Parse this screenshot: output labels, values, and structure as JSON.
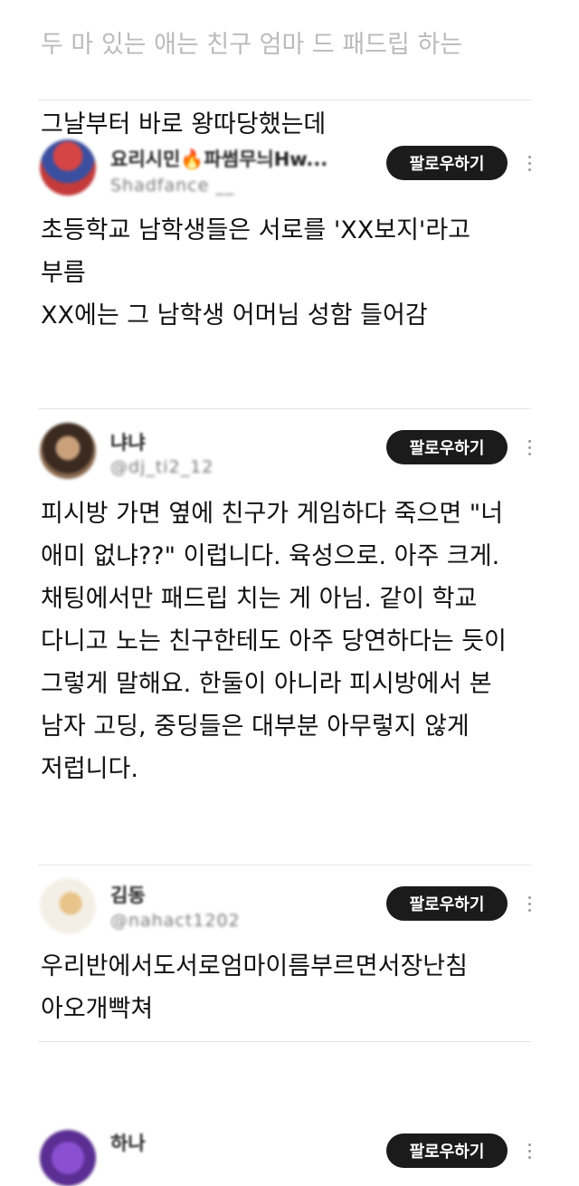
{
  "top_text": {
    "cut_line": "두 마 있는 애는 친구 엄마 드 패드립 하는",
    "line": "그날부터 바로 왕따당했는데"
  },
  "posts": [
    {
      "name": "요리시민🔥파썸무늬Hw...",
      "handle": "Shadfance __",
      "follow_label": "팔로우하기",
      "text": "초등학교 남학생들은 서로를 'XX보지'라고\n부름\nXX에는 그 남학생 어머님 성함 들어감"
    },
    {
      "name": "냐냐",
      "handle": "@dj_ti2_12",
      "follow_label": "팔로우하기",
      "text": "피시방 가면 옆에 친구가 게임하다 죽으면 \"너\n애미 없냐??\" 이럽니다. 육성으로. 아주 크게.\n채팅에서만 패드립 치는 게 아님. 같이 학교\n다니고 노는 친구한테도 아주 당연하다는 듯이\n그렇게 말해요. 한둘이 아니라 피시방에서 본\n남자 고딩, 중딩들은 대부분 아무렇지 않게\n저럽니다."
    },
    {
      "name": "김동",
      "handle": "@nahact1202",
      "follow_label": "팔로우하기",
      "text": "우리반에서도서로엄마이름부르면서장난침\n아오개빡쳐"
    },
    {
      "name": "하나",
      "handle": "",
      "follow_label": "팔로우하기",
      "text": ""
    }
  ],
  "icons": {
    "more": "more-vertical-icon",
    "avatar": "avatar"
  },
  "colors": {
    "follow_bg": "#1b1b1b",
    "follow_text": "#ffffff",
    "divider": "#e6e6e6"
  }
}
